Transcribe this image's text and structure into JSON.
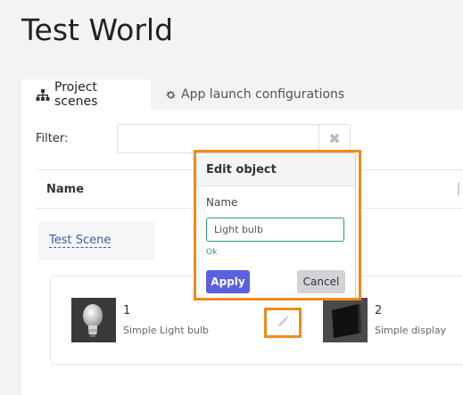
{
  "page": {
    "title": "Test World"
  },
  "tabs": [
    {
      "label": "Project scenes",
      "icon": "sitemap-icon",
      "active": true
    },
    {
      "label": "App launch configurations",
      "icon": "gear-icon",
      "active": false
    }
  ],
  "filter": {
    "label": "Filter:",
    "value": "",
    "clear_icon": "close-icon"
  },
  "table": {
    "column_name": "Name"
  },
  "scene": {
    "name": "Test Scene"
  },
  "objects": [
    {
      "number": "1",
      "description": "Simple Light bulb",
      "thumb": "light-bulb"
    },
    {
      "number": "2",
      "description": "Simple display",
      "thumb": "display"
    }
  ],
  "popover": {
    "title": "Edit object",
    "name_label": "Name",
    "name_value": "Light bulb",
    "validation": "Ok",
    "apply_label": "Apply",
    "cancel_label": "Cancel"
  },
  "colors": {
    "highlight": "#f08a1c",
    "apply": "#5b5fe0",
    "valid": "#2e9a6b",
    "link": "#3b5ea8"
  }
}
